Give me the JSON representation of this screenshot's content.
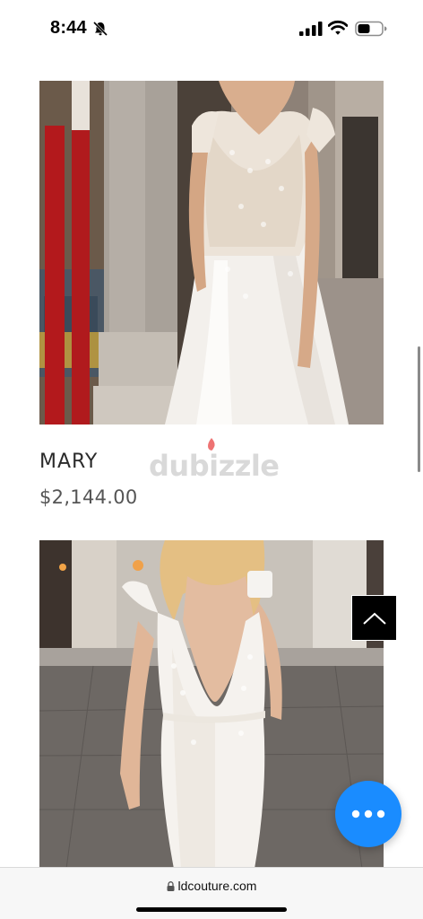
{
  "status_bar": {
    "time": "8:44",
    "icons": [
      "bell-slash-icon",
      "signal-icon",
      "wifi-icon",
      "battery-icon"
    ]
  },
  "products": [
    {
      "name": "MARY",
      "price": "$2,144.00"
    },
    {
      "name": "",
      "price": ""
    }
  ],
  "watermark": {
    "text": "dubizzle",
    "accent_color": "#e00000"
  },
  "browser": {
    "url": "ldcouture.com",
    "lock_icon": "lock-icon"
  },
  "buttons": {
    "scroll_top_icon": "chevron-up-icon",
    "chat_icon": "more-dots-icon",
    "chat_color": "#1a8cff"
  }
}
